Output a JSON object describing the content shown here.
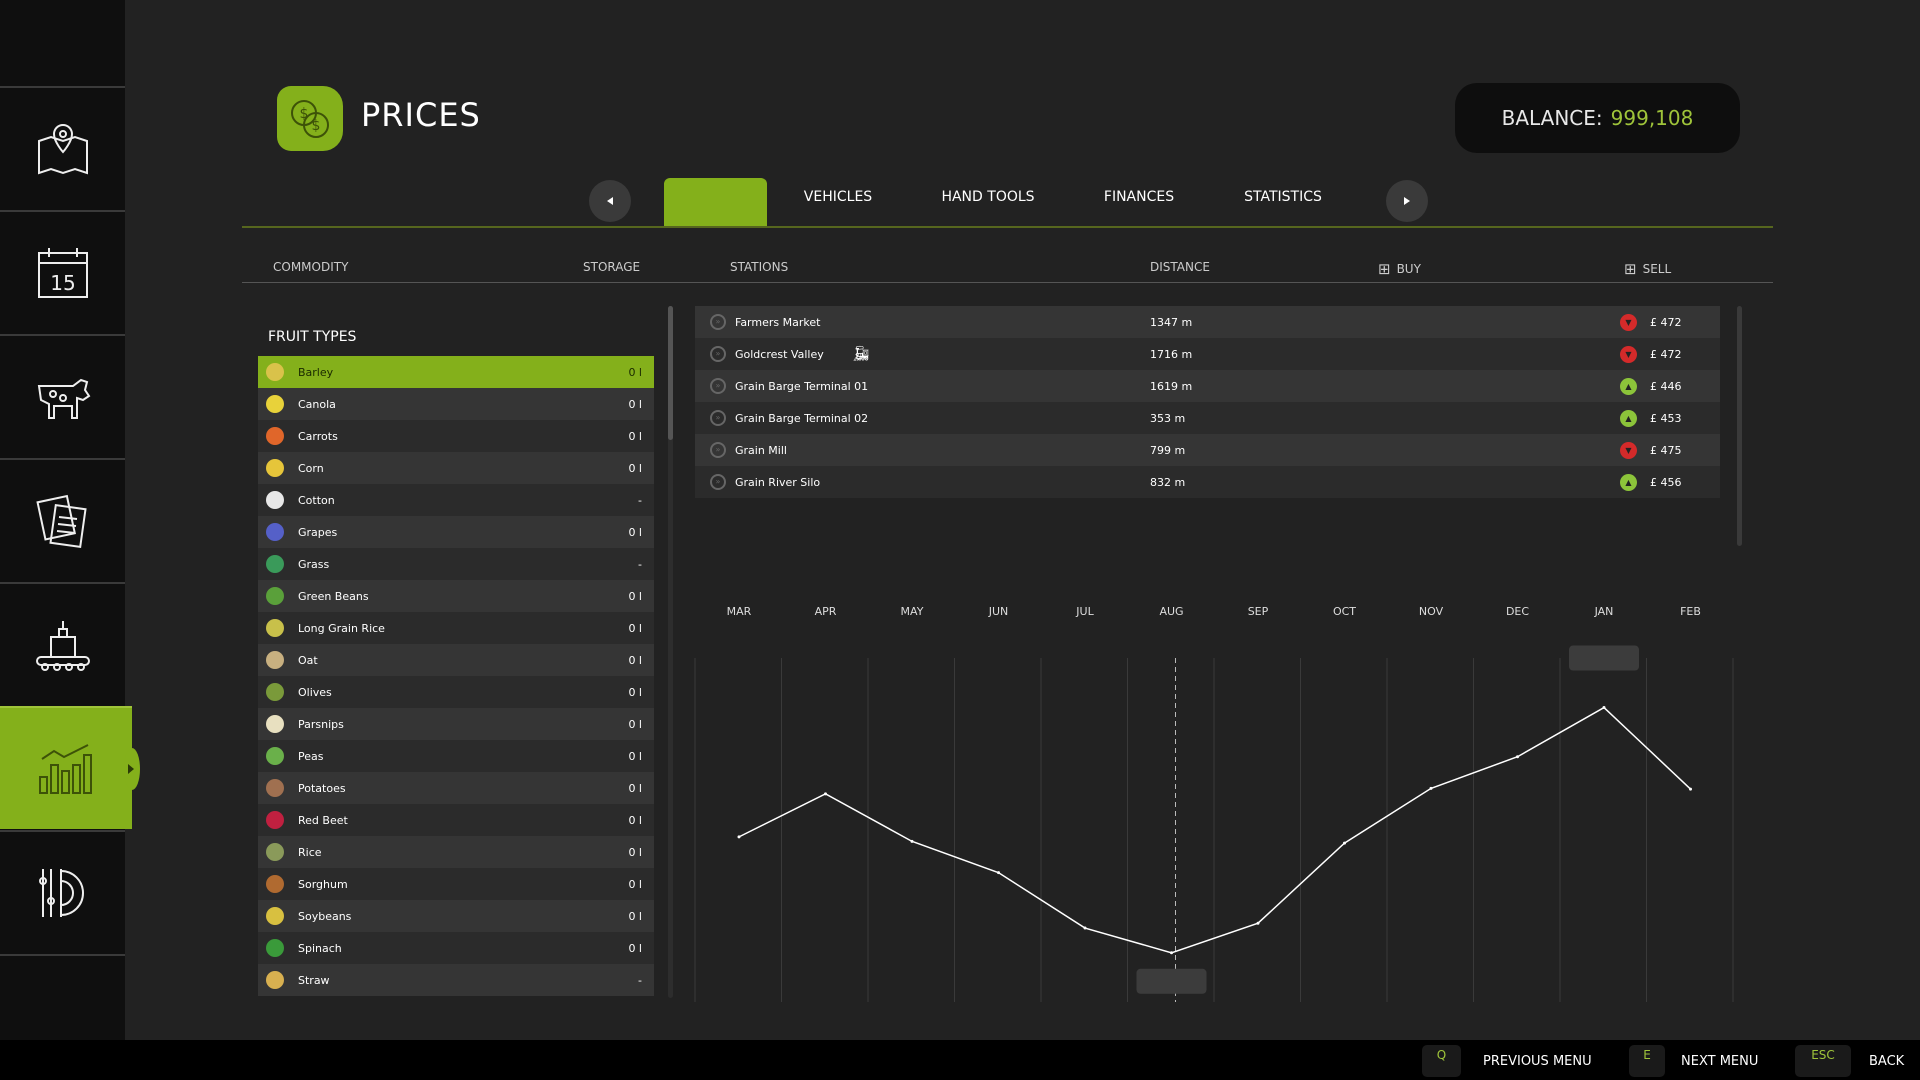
{
  "sidebar": {
    "items": [
      {
        "icon": "map-icon",
        "active": false
      },
      {
        "icon": "calendar-icon",
        "label": "15",
        "active": false
      },
      {
        "icon": "animals-icon",
        "active": false
      },
      {
        "icon": "contracts-icon",
        "active": false
      },
      {
        "icon": "production-icon",
        "active": false
      },
      {
        "icon": "prices-chart-icon",
        "active": true
      },
      {
        "icon": "settings-icon",
        "active": false
      }
    ]
  },
  "header": {
    "title": "PRICES",
    "icon": "coins-icon",
    "balance_label": "BALANCE:",
    "balance_value": "999,108"
  },
  "tabs": {
    "items": [
      {
        "label": "VEHICLES"
      },
      {
        "label": "HAND TOOLS"
      },
      {
        "label": "FINANCES"
      },
      {
        "label": "STATISTICS"
      }
    ]
  },
  "columns": {
    "commodity": "COMMODITY",
    "storage": "STORAGE",
    "stations": "STATIONS",
    "distance": "DISTANCE",
    "buy": "BUY",
    "sell": "SELL"
  },
  "fruit": {
    "title": "FRUIT TYPES",
    "items": [
      {
        "name": "Barley",
        "storage": "0 l",
        "color": "#d9c24a",
        "selected": true
      },
      {
        "name": "Canola",
        "storage": "0 l",
        "color": "#e8d23a"
      },
      {
        "name": "Carrots",
        "storage": "0 l",
        "color": "#e0662a"
      },
      {
        "name": "Corn",
        "storage": "0 l",
        "color": "#e6c53a"
      },
      {
        "name": "Cotton",
        "storage": "-",
        "color": "#e8e8e8"
      },
      {
        "name": "Grapes",
        "storage": "0 l",
        "color": "#5560c8"
      },
      {
        "name": "Grass",
        "storage": "-",
        "color": "#3a9a5a"
      },
      {
        "name": "Green Beans",
        "storage": "0 l",
        "color": "#5aa03a"
      },
      {
        "name": "Long Grain Rice",
        "storage": "0 l",
        "color": "#c8c04a"
      },
      {
        "name": "Oat",
        "storage": "0 l",
        "color": "#c8b080"
      },
      {
        "name": "Olives",
        "storage": "0 l",
        "color": "#7a9a3a"
      },
      {
        "name": "Parsnips",
        "storage": "0 l",
        "color": "#e8e0c0"
      },
      {
        "name": "Peas",
        "storage": "0 l",
        "color": "#6ab04a"
      },
      {
        "name": "Potatoes",
        "storage": "0 l",
        "color": "#a07050"
      },
      {
        "name": "Red Beet",
        "storage": "0 l",
        "color": "#c02040"
      },
      {
        "name": "Rice",
        "storage": "0 l",
        "color": "#8a9a5a"
      },
      {
        "name": "Sorghum",
        "storage": "0 l",
        "color": "#b06a30"
      },
      {
        "name": "Soybeans",
        "storage": "0 l",
        "color": "#d8c040"
      },
      {
        "name": "Spinach",
        "storage": "0 l",
        "color": "#3a9a3a"
      },
      {
        "name": "Straw",
        "storage": "-",
        "color": "#d8b050"
      }
    ]
  },
  "stations": [
    {
      "name": "Farmers Market",
      "distance": "1347 m",
      "trend": "down",
      "price": "£ 472"
    },
    {
      "name": "Goldcrest Valley",
      "train": true,
      "distance": "1716 m",
      "trend": "down",
      "price": "£ 472"
    },
    {
      "name": "Grain Barge Terminal 01",
      "distance": "1619 m",
      "trend": "up",
      "price": "£ 446"
    },
    {
      "name": "Grain Barge Terminal 02",
      "distance": "353 m",
      "trend": "up",
      "price": "£ 453"
    },
    {
      "name": "Grain Mill",
      "distance": "799 m",
      "trend": "down",
      "price": "£ 475"
    },
    {
      "name": "Grain River Silo",
      "distance": "832 m",
      "trend": "up",
      "price": "£ 456"
    }
  ],
  "colors": {
    "accent": "#84b01b",
    "down": "#d42a2a",
    "up": "#8cc43a"
  },
  "chart_data": {
    "type": "line",
    "categories": [
      "MAR",
      "APR",
      "MAY",
      "JUN",
      "JUL",
      "AUG",
      "SEP",
      "OCT",
      "NOV",
      "DEC",
      "JAN",
      "FEB"
    ],
    "values": [
      48,
      60.5,
      46.7,
      37.6,
      21.5,
      14.3,
      22.9,
      46.2,
      62.1,
      71.3,
      85.6,
      61.9
    ],
    "ylim": [
      0,
      100
    ],
    "current_month": "AUG",
    "grid": true
  },
  "footer": {
    "keys": [
      {
        "key": "Q",
        "label": "PREVIOUS MENU"
      },
      {
        "key": "E",
        "label": "NEXT MENU"
      },
      {
        "key": "ESC",
        "label": "BACK"
      }
    ]
  }
}
